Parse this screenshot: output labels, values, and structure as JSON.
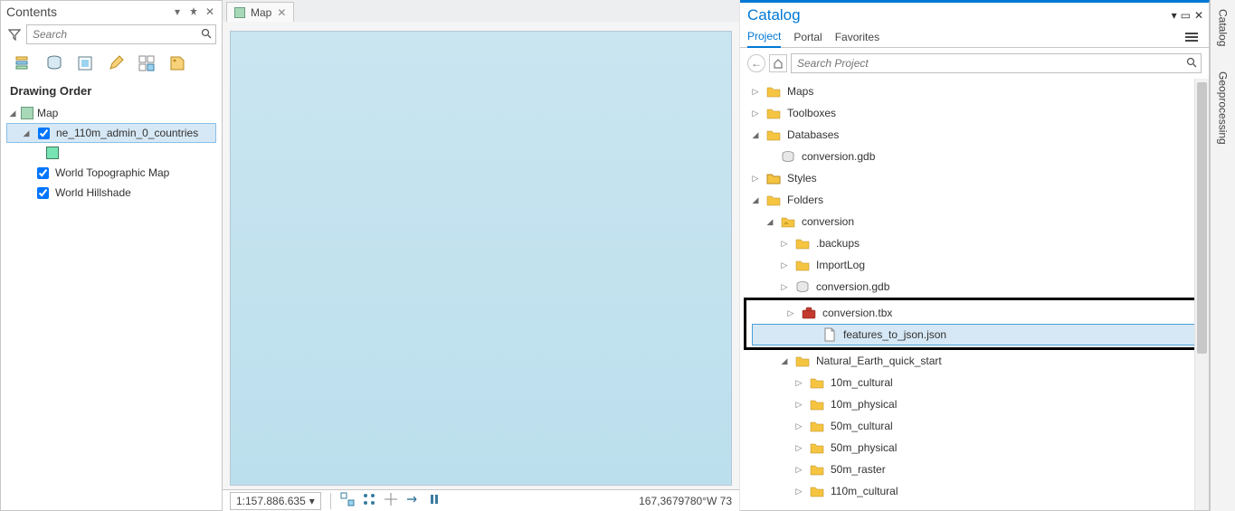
{
  "contents": {
    "title": "Contents",
    "search_placeholder": "Search",
    "drawing_order_label": "Drawing Order",
    "map_label": "Map",
    "layers": {
      "ne": "ne_110m_admin_0_countries",
      "topo": "World Topographic Map",
      "hillshade": "World Hillshade"
    }
  },
  "map": {
    "tab_label": "Map",
    "scale": "1:157.886.635",
    "coord": "167,3679780°W 73"
  },
  "catalog": {
    "title": "Catalog",
    "tabs": {
      "project": "Project",
      "portal": "Portal",
      "favorites": "Favorites"
    },
    "search_placeholder": "Search Project",
    "nodes": {
      "maps": "Maps",
      "toolboxes": "Toolboxes",
      "databases": "Databases",
      "conversion_gdb": "conversion.gdb",
      "styles": "Styles",
      "folders": "Folders",
      "conversion": "conversion",
      "backups": ".backups",
      "importlog": "ImportLog",
      "conversion_gdb2": "conversion.gdb",
      "conversion_tbx": "conversion.tbx",
      "features_json": "features_to_json.json",
      "natural_earth": "Natural_Earth_quick_start",
      "cult10": "10m_cultural",
      "phys10": "10m_physical",
      "cult50": "50m_cultural",
      "phys50": "50m_physical",
      "raster50": "50m_raster",
      "cult110": "110m_cultural"
    }
  },
  "side": {
    "catalog": "Catalog",
    "geo": "Geoprocessing"
  }
}
